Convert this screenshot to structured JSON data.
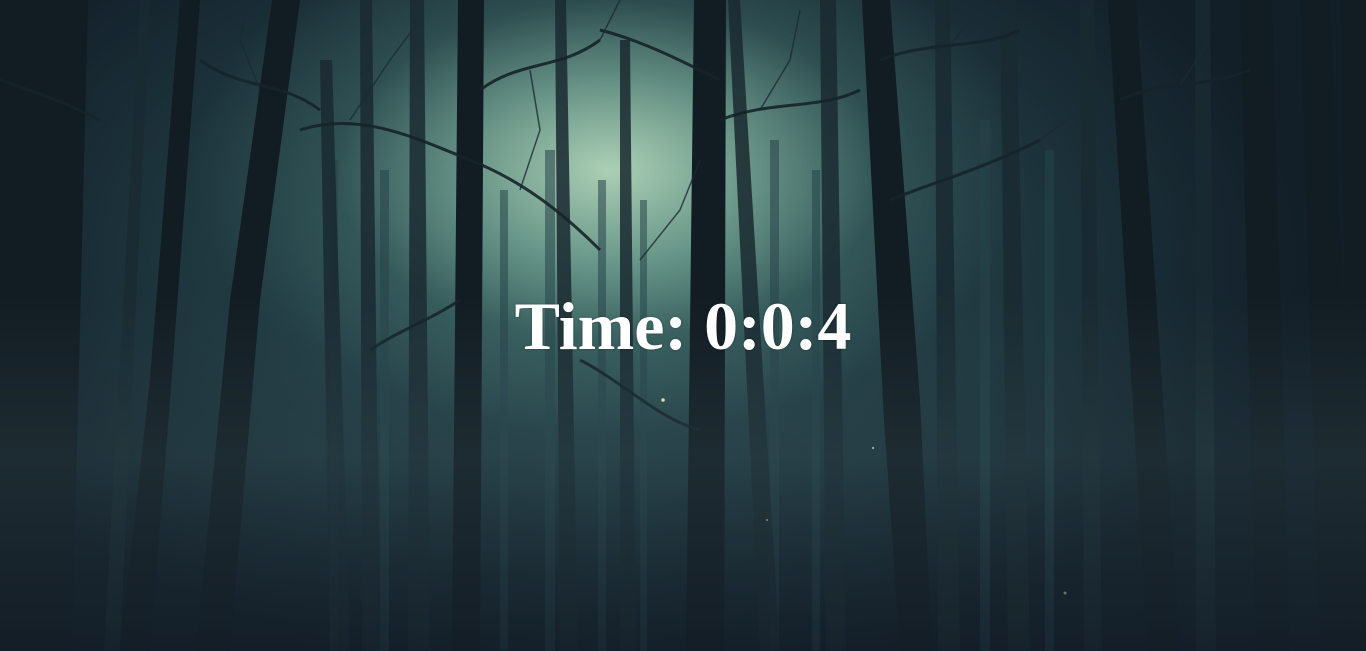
{
  "timer": {
    "label": "Time:",
    "value": "0:0:4"
  },
  "background": {
    "scene": "misty-forest-background"
  },
  "colors": {
    "text": "#ffffff",
    "glow": "#b2d6ba",
    "dark": "#0f1620"
  }
}
